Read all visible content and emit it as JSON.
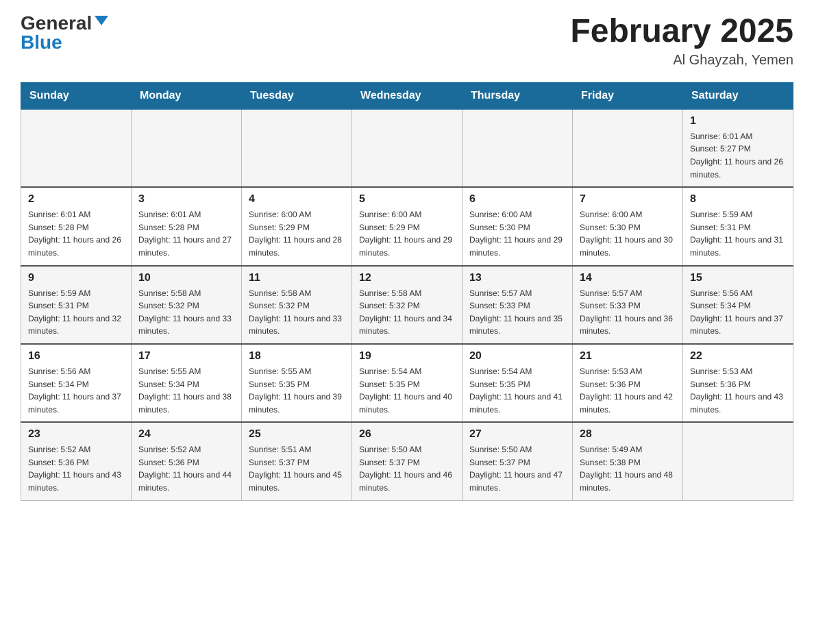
{
  "header": {
    "logo_general": "General",
    "logo_blue": "Blue",
    "month_title": "February 2025",
    "location": "Al Ghayzah, Yemen"
  },
  "days_of_week": [
    "Sunday",
    "Monday",
    "Tuesday",
    "Wednesday",
    "Thursday",
    "Friday",
    "Saturday"
  ],
  "weeks": [
    {
      "days": [
        {
          "number": "",
          "info": ""
        },
        {
          "number": "",
          "info": ""
        },
        {
          "number": "",
          "info": ""
        },
        {
          "number": "",
          "info": ""
        },
        {
          "number": "",
          "info": ""
        },
        {
          "number": "",
          "info": ""
        },
        {
          "number": "1",
          "info": "Sunrise: 6:01 AM\nSunset: 5:27 PM\nDaylight: 11 hours and 26 minutes."
        }
      ]
    },
    {
      "days": [
        {
          "number": "2",
          "info": "Sunrise: 6:01 AM\nSunset: 5:28 PM\nDaylight: 11 hours and 26 minutes."
        },
        {
          "number": "3",
          "info": "Sunrise: 6:01 AM\nSunset: 5:28 PM\nDaylight: 11 hours and 27 minutes."
        },
        {
          "number": "4",
          "info": "Sunrise: 6:00 AM\nSunset: 5:29 PM\nDaylight: 11 hours and 28 minutes."
        },
        {
          "number": "5",
          "info": "Sunrise: 6:00 AM\nSunset: 5:29 PM\nDaylight: 11 hours and 29 minutes."
        },
        {
          "number": "6",
          "info": "Sunrise: 6:00 AM\nSunset: 5:30 PM\nDaylight: 11 hours and 29 minutes."
        },
        {
          "number": "7",
          "info": "Sunrise: 6:00 AM\nSunset: 5:30 PM\nDaylight: 11 hours and 30 minutes."
        },
        {
          "number": "8",
          "info": "Sunrise: 5:59 AM\nSunset: 5:31 PM\nDaylight: 11 hours and 31 minutes."
        }
      ]
    },
    {
      "days": [
        {
          "number": "9",
          "info": "Sunrise: 5:59 AM\nSunset: 5:31 PM\nDaylight: 11 hours and 32 minutes."
        },
        {
          "number": "10",
          "info": "Sunrise: 5:58 AM\nSunset: 5:32 PM\nDaylight: 11 hours and 33 minutes."
        },
        {
          "number": "11",
          "info": "Sunrise: 5:58 AM\nSunset: 5:32 PM\nDaylight: 11 hours and 33 minutes."
        },
        {
          "number": "12",
          "info": "Sunrise: 5:58 AM\nSunset: 5:32 PM\nDaylight: 11 hours and 34 minutes."
        },
        {
          "number": "13",
          "info": "Sunrise: 5:57 AM\nSunset: 5:33 PM\nDaylight: 11 hours and 35 minutes."
        },
        {
          "number": "14",
          "info": "Sunrise: 5:57 AM\nSunset: 5:33 PM\nDaylight: 11 hours and 36 minutes."
        },
        {
          "number": "15",
          "info": "Sunrise: 5:56 AM\nSunset: 5:34 PM\nDaylight: 11 hours and 37 minutes."
        }
      ]
    },
    {
      "days": [
        {
          "number": "16",
          "info": "Sunrise: 5:56 AM\nSunset: 5:34 PM\nDaylight: 11 hours and 37 minutes."
        },
        {
          "number": "17",
          "info": "Sunrise: 5:55 AM\nSunset: 5:34 PM\nDaylight: 11 hours and 38 minutes."
        },
        {
          "number": "18",
          "info": "Sunrise: 5:55 AM\nSunset: 5:35 PM\nDaylight: 11 hours and 39 minutes."
        },
        {
          "number": "19",
          "info": "Sunrise: 5:54 AM\nSunset: 5:35 PM\nDaylight: 11 hours and 40 minutes."
        },
        {
          "number": "20",
          "info": "Sunrise: 5:54 AM\nSunset: 5:35 PM\nDaylight: 11 hours and 41 minutes."
        },
        {
          "number": "21",
          "info": "Sunrise: 5:53 AM\nSunset: 5:36 PM\nDaylight: 11 hours and 42 minutes."
        },
        {
          "number": "22",
          "info": "Sunrise: 5:53 AM\nSunset: 5:36 PM\nDaylight: 11 hours and 43 minutes."
        }
      ]
    },
    {
      "days": [
        {
          "number": "23",
          "info": "Sunrise: 5:52 AM\nSunset: 5:36 PM\nDaylight: 11 hours and 43 minutes."
        },
        {
          "number": "24",
          "info": "Sunrise: 5:52 AM\nSunset: 5:36 PM\nDaylight: 11 hours and 44 minutes."
        },
        {
          "number": "25",
          "info": "Sunrise: 5:51 AM\nSunset: 5:37 PM\nDaylight: 11 hours and 45 minutes."
        },
        {
          "number": "26",
          "info": "Sunrise: 5:50 AM\nSunset: 5:37 PM\nDaylight: 11 hours and 46 minutes."
        },
        {
          "number": "27",
          "info": "Sunrise: 5:50 AM\nSunset: 5:37 PM\nDaylight: 11 hours and 47 minutes."
        },
        {
          "number": "28",
          "info": "Sunrise: 5:49 AM\nSunset: 5:38 PM\nDaylight: 11 hours and 48 minutes."
        },
        {
          "number": "",
          "info": ""
        }
      ]
    }
  ]
}
